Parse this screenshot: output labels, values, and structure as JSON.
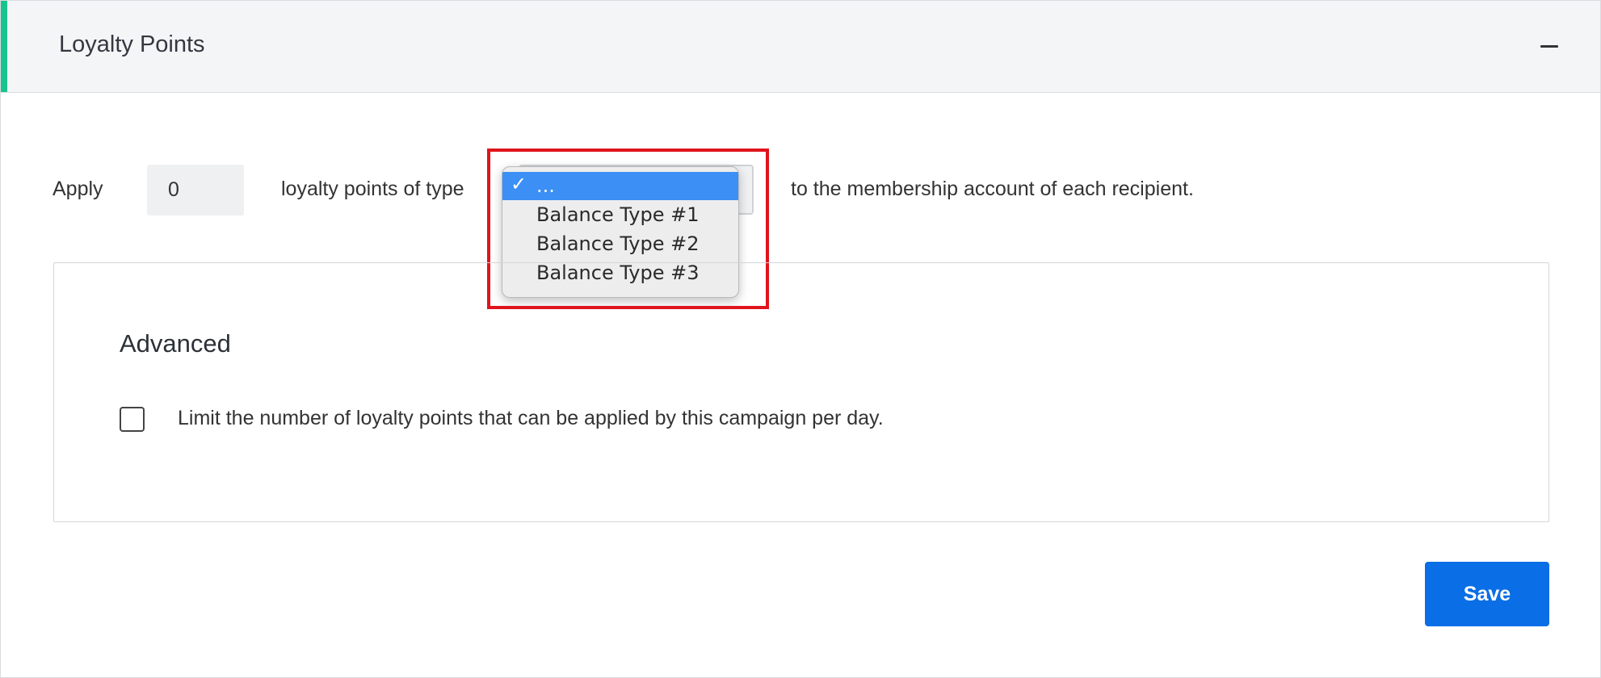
{
  "header": {
    "title": "Loyalty Points",
    "collapse_icon": "minus-icon"
  },
  "apply_row": {
    "apply_label": "Apply",
    "points_value": "0",
    "type_label": "loyalty points of type",
    "after_label": "to the membership account of each recipient."
  },
  "balance_type_select": {
    "selected": "...",
    "options": [
      "...",
      "Balance Type #1",
      "Balance Type #2",
      "Balance Type #3"
    ],
    "checkmark": "✓"
  },
  "advanced": {
    "title": "Advanced",
    "limit_checkbox_label": "Limit the number of loyalty points that can be applied by this campaign per day."
  },
  "actions": {
    "save_label": "Save"
  },
  "colors": {
    "accent": "#18c48e",
    "primary_button": "#0a6ee6",
    "dropdown_selected": "#3b8ff5",
    "highlight": "#e0141c"
  }
}
